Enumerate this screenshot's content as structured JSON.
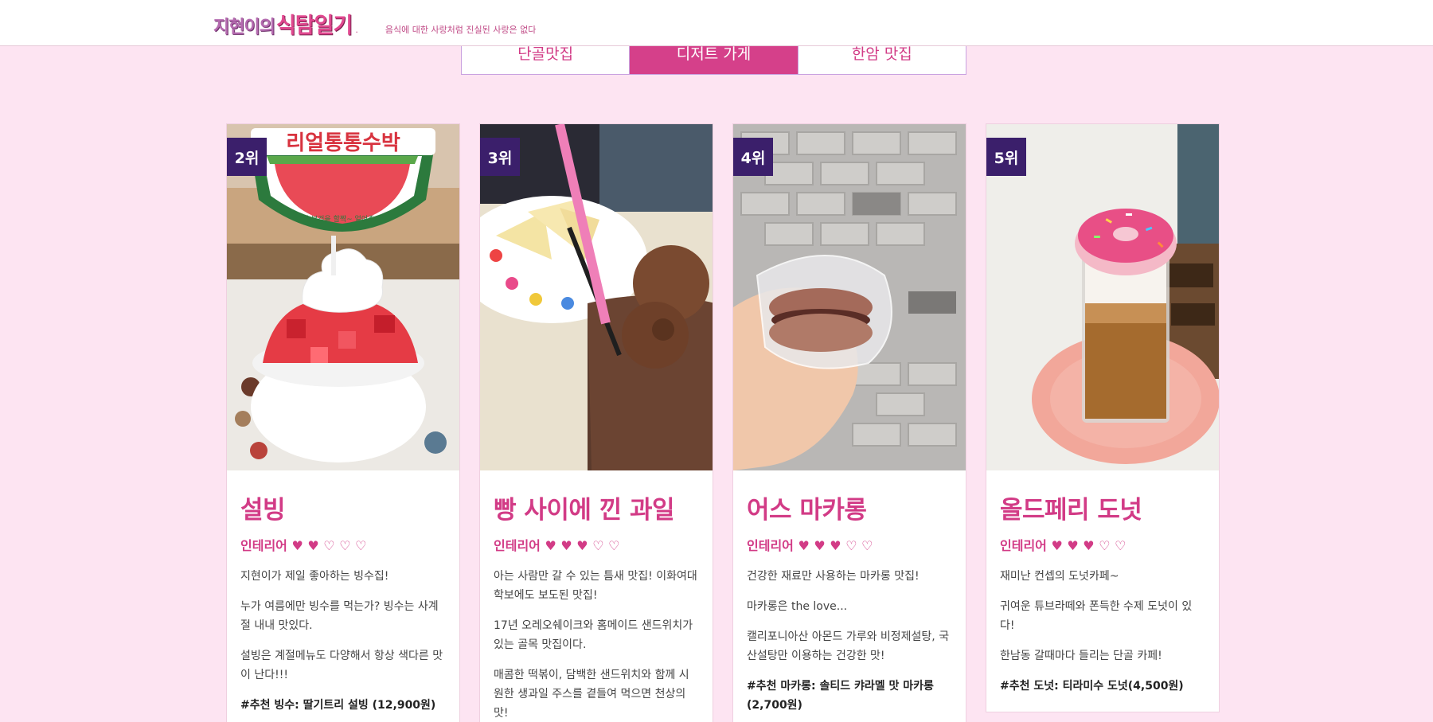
{
  "header": {
    "logo_part1": "지현이의",
    "logo_part2": "식탐일기",
    "logo_dot": ".",
    "tagline": "음식에 대한 사랑처럼 진실된 사랑은 없다"
  },
  "tabs": [
    {
      "label": "단골맛집",
      "active": false
    },
    {
      "label": "디저트 가게",
      "active": true
    },
    {
      "label": "한암 맛집",
      "active": false
    }
  ],
  "cards": [
    {
      "rank": "2위",
      "title": "설빙",
      "rating": "인테리어 ♥ ♥ ♡ ♡ ♡",
      "paragraphs": [
        "지현이가 제일 좋아하는 빙수집!",
        "누가 여름에만 빙수를 먹는가? 빙수는 사계절 내내 맛있다.",
        "설빙은 계절메뉴도 다양해서 항상 색다른 맛이 난다!!!"
      ],
      "recommendation": "#추천 빙수: 딸기트리 설빙 (12,900원)",
      "photo_sign": "리얼통통수박",
      "photo_sign_sub": "수박 부것을 할짝~ 얼어주세요!"
    },
    {
      "rank": "3위",
      "title": "빵 사이에 낀 과일",
      "rating": "인테리어 ♥ ♥ ♥ ♡ ♡",
      "paragraphs": [
        "아는 사람만 갈 수 있는 틈새 맛집! 이화여대 학보에도 보도된 맛집!",
        "17년 오레오쉐이크와 홈메이드 샌드위치가 있는 골목 맛집이다.",
        "매콤한 떡볶이, 담백한 샌드위치와 함께 시원한 생과일 주스를 곁들여 먹으면 천상의 맛!"
      ],
      "recommendation": ""
    },
    {
      "rank": "4위",
      "title": "어스 마카롱",
      "rating": "인테리어 ♥ ♥ ♥ ♡ ♡",
      "paragraphs": [
        "건강한 재료만 사용하는 마카롱 맛집!",
        "마카롱은 the love...",
        "캘리포니아산 아몬드 가루와 비정제설탕, 국산설탕만 이용하는 건강한 맛!"
      ],
      "recommendation": "#추천 마카롱: 솔티드 캬라멜 맛 마카롱 (2,700원)"
    },
    {
      "rank": "5위",
      "title": "올드페리 도넛",
      "rating": "인테리어 ♥ ♥ ♥ ♡ ♡",
      "paragraphs": [
        "재미난 컨셉의 도넛카페~",
        "귀여운 튜브라떼와 폰득한 수제 도넛이 있다!",
        "한남동 갈때마다 들리는 단골 카페!"
      ],
      "recommendation": "#추천 도넛: 티라미수 도넛(4,500원)"
    }
  ],
  "colors": {
    "background": "#fde4f2",
    "accent": "#d23b86",
    "rank_badge": "#3b1f6b"
  }
}
